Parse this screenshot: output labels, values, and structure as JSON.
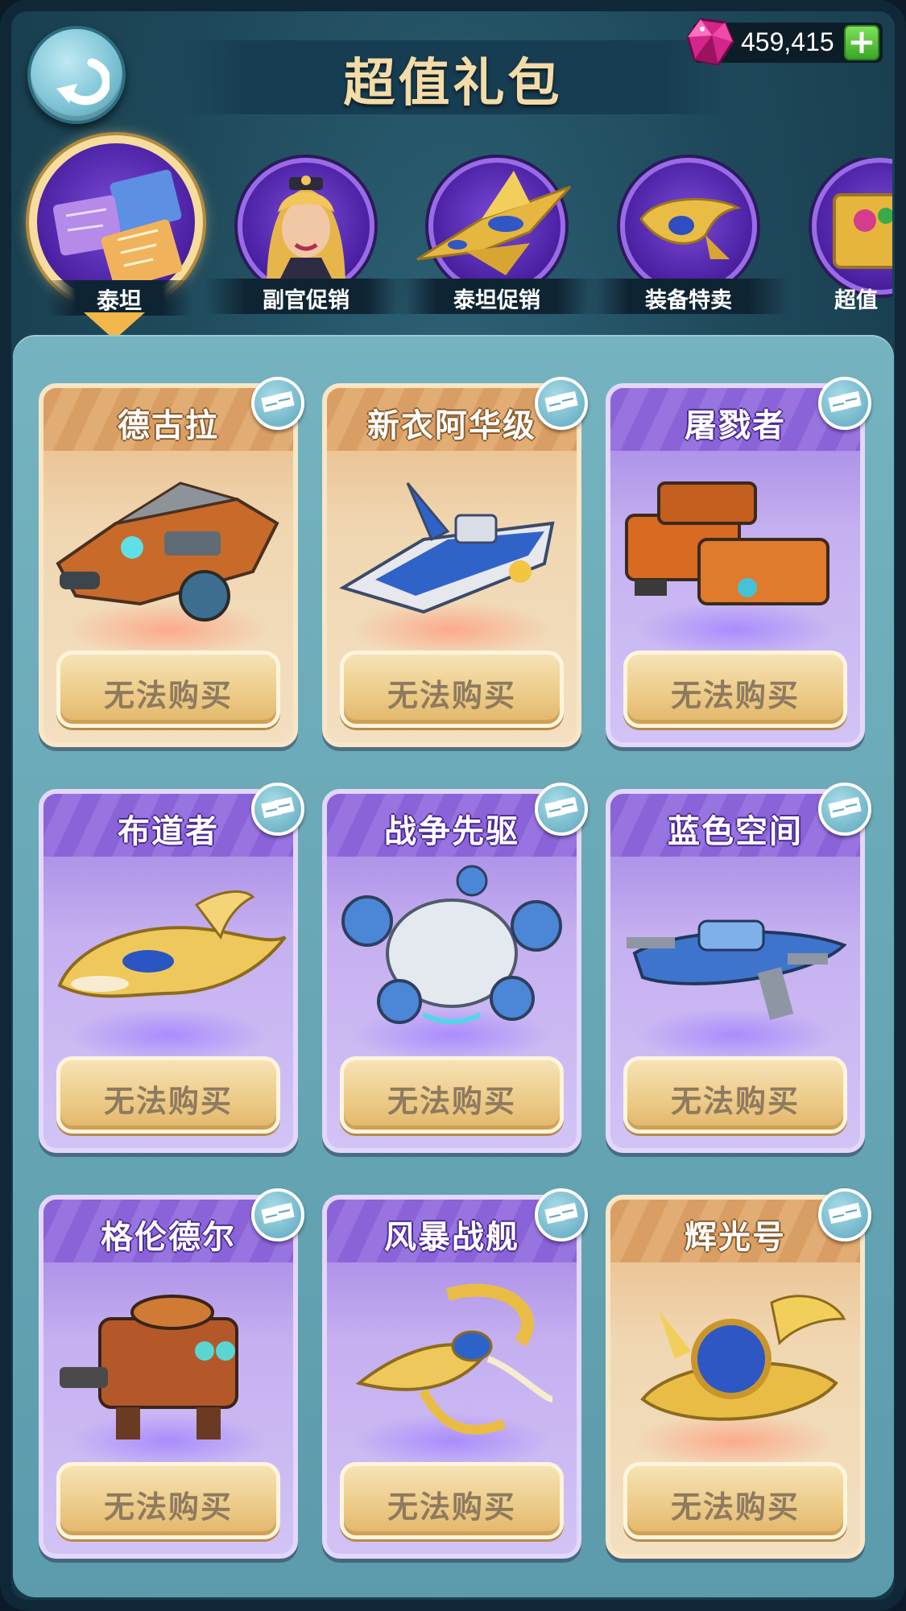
{
  "header": {
    "title": "超值礼包",
    "currency_amount": "459,415",
    "plus_label": "+"
  },
  "tabs": [
    {
      "label": "泰坦",
      "icon": "blueprint-papers-icon",
      "active": true
    },
    {
      "label": "副官促销",
      "icon": "officer-portrait-icon",
      "active": false
    },
    {
      "label": "泰坦促销",
      "icon": "golden-ship-icon",
      "active": false
    },
    {
      "label": "装备特卖",
      "icon": "equipment-icon",
      "active": false
    },
    {
      "label": "超值礼",
      "icon": "gift-box-icon",
      "active": false
    }
  ],
  "cards": [
    {
      "name": "德古拉",
      "theme": "gold",
      "button": "无法购买",
      "ship": "orange-armored-ship"
    },
    {
      "name": "新衣阿华级",
      "theme": "gold",
      "button": "无法购买",
      "ship": "blue-cruiser-ship"
    },
    {
      "name": "屠戮者",
      "theme": "purple",
      "button": "无法购买",
      "ship": "orange-tank-ship"
    },
    {
      "name": "布道者",
      "theme": "purple",
      "button": "无法购买",
      "ship": "golden-manta-ship"
    },
    {
      "name": "战争先驱",
      "theme": "purple",
      "button": "无法购买",
      "ship": "white-airship"
    },
    {
      "name": "蓝色空间",
      "theme": "purple",
      "button": "无法购买",
      "ship": "blue-battleship"
    },
    {
      "name": "格伦德尔",
      "theme": "purple",
      "button": "无法购买",
      "ship": "rust-mech-ship"
    },
    {
      "name": "风暴战舰",
      "theme": "purple",
      "button": "无法购买",
      "ship": "golden-claw-ship"
    },
    {
      "name": "辉光号",
      "theme": "gold",
      "button": "无法购买",
      "ship": "golden-orb-ship"
    }
  ],
  "colors": {
    "title": "#f3dca7",
    "gold_card": "#f0d7b2",
    "purple_card": "#c5b0f0",
    "button": "#ecca86",
    "panel": "#6aa8b6"
  }
}
